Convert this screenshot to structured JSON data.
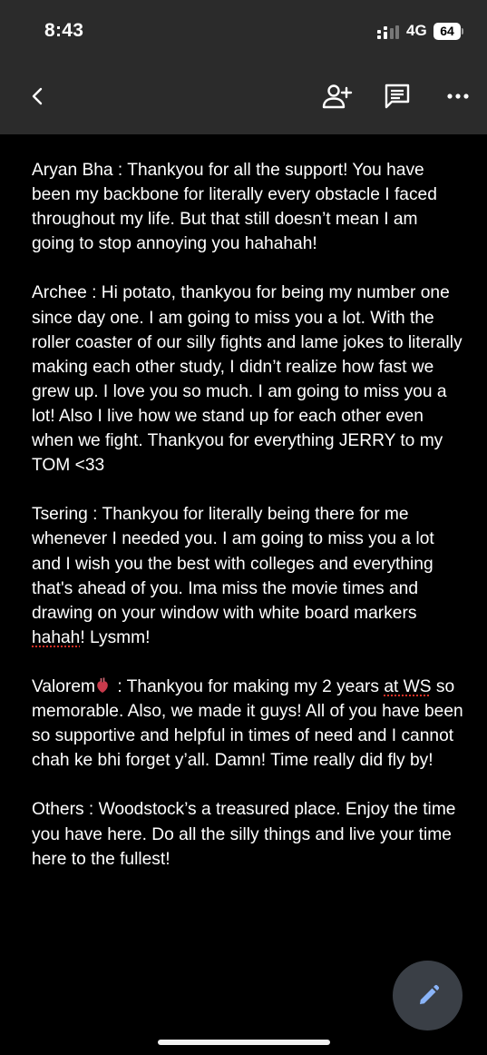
{
  "status": {
    "time": "8:43",
    "network": "4G",
    "battery": "64"
  },
  "toolbar": {
    "icons": [
      "arrow-back-icon",
      "person-add-icon",
      "comment-icon",
      "more-horizontal-icon"
    ]
  },
  "doc": {
    "aryan": "Aryan Bha : Thankyou for all the support! You have been my backbone for literally every obstacle I faced throughout my life. But that still doesn’t mean I am going to stop annoying you hahahah!",
    "archee": "Archee : Hi potato, thankyou for being my number one since day one. I am going to miss you a lot. With the roller coaster of our silly fights and lame jokes to literally making each other study, I didn’t realize how fast we grew up. I love you so much. I am going to miss you a lot! Also I live how we stand up for each other even when we fight. Thankyou for everything JERRY to my TOM <33",
    "tsering_a": "Tsering : Thankyou for literally being there for me whenever I needed you. I am going to miss you a lot and I wish you the best with colleges and everything that's ahead of you. Ima miss the movie times and drawing on your window with white board markers ",
    "tsering_b": "hahah",
    "tsering_c": "! Lysmm!",
    "valorem_a": "Valorem",
    "valorem_b": " : Thankyou for making my 2 years ",
    "valorem_c": "at WS",
    "valorem_d": " so memorable. Also, we made it guys! All of you have been so supportive and helpful in times of need and I cannot chah ke bhi forget y’all. Damn! Time really did fly by!",
    "others": "Others : Woodstock’s a treasured place. Enjoy the time you have here. Do all the silly things and live your time here to the fullest!"
  },
  "colors": {
    "toolbar_bg": "#2b2b2b",
    "page_bg": "#000000",
    "fab_bg": "#3a3f46",
    "fab_icon": "#8ab4f8",
    "spellcheck": "#d93025"
  }
}
